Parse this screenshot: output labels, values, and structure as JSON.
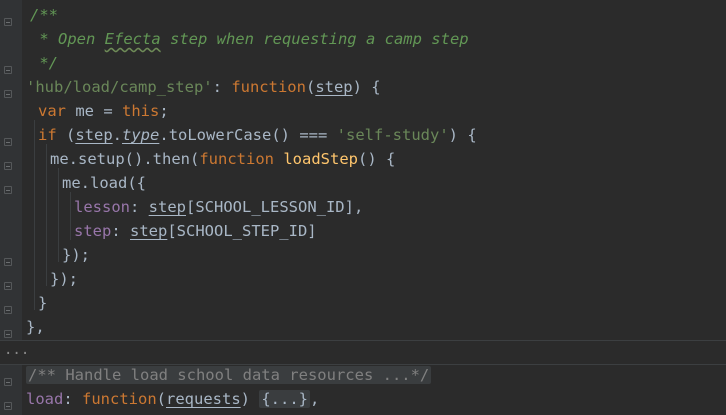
{
  "editor": {
    "lines": {
      "l1": "/**",
      "l2_a": " * Open ",
      "l2_typo": "Efecta",
      "l2_b": " step when requesting a camp step",
      "l3": " */",
      "l4_key": "'hub/load/camp_step'",
      "l4_colon": ": ",
      "l4_fn": "function",
      "l4_open": "(",
      "l4_param": "step",
      "l4_close": ") {",
      "l5_var": "var",
      "l5_me": " me = ",
      "l5_this": "this",
      "l5_end": ";",
      "l6_if": "if",
      "l6_open": " (",
      "l6_step": "step",
      "l6_dot1": ".",
      "l6_type": "type",
      "l6_dot2": ".",
      "l6_call": "toLowerCase",
      "l6_mid": "() === ",
      "l6_str": "'self-study'",
      "l6_end": ") {",
      "l7_me": "me.",
      "l7_setup": "setup",
      "l7_mid": "().",
      "l7_then": "then",
      "l7_open": "(",
      "l7_fn": "function",
      "l7_sp": " ",
      "l7_name": "loadStep",
      "l7_end": "() {",
      "l8_me": "me.",
      "l8_load": "load",
      "l8_end": "({",
      "l9_key": "lesson",
      "l9_colon": ": ",
      "l9_step": "step",
      "l9_const": "[SCHOOL_LESSON_ID]",
      "l9_end": ",",
      "l10_key": "step",
      "l10_colon": ": ",
      "l10_step": "step",
      "l10_const": "[SCHOOL_STEP_ID]",
      "l11": "});",
      "l12": "});",
      "l13": "}",
      "l14": "},",
      "fold_dots": "...",
      "l15_comment": "/** Handle load school data resources ...*/",
      "l16_key": "load",
      "l16_colon": ": ",
      "l16_fn": "function",
      "l16_open": "(",
      "l16_param": "requests",
      "l16_close": ") ",
      "l16_collapsed": "{...}",
      "l16_end": ","
    }
  },
  "colors": {
    "background": "#2b2b2b",
    "gutter": "#313335",
    "comment": "#629755",
    "keyword": "#cc7832",
    "string": "#6a8759",
    "function_name": "#ffc66d",
    "property": "#9876aa",
    "identifier": "#a9b7c6"
  }
}
